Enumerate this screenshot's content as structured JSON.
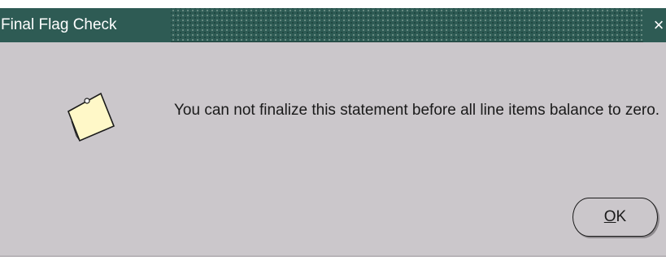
{
  "window": {
    "title": "Final Flag Check",
    "close_label": "×"
  },
  "message": {
    "text": "You can not finalize this statement before all line items balance to zero."
  },
  "icon": {
    "name": "note-icon"
  },
  "buttons": {
    "ok_mnemonic": "O",
    "ok_rest": "K"
  },
  "colors": {
    "titlebar": "#2e5b54",
    "dialog_bg": "#cbc7cb",
    "note_fill": "#fff8c8"
  }
}
